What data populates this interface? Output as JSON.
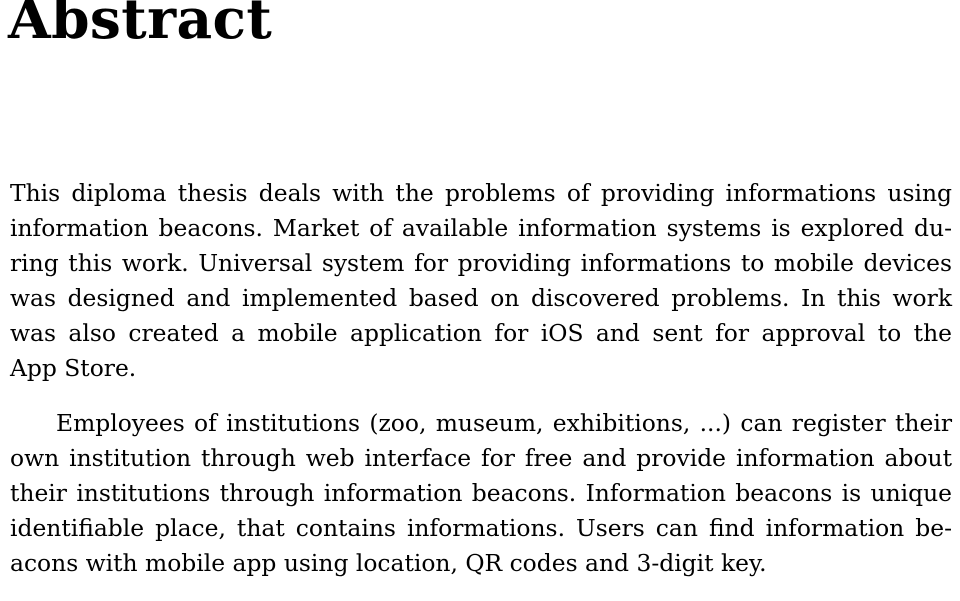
{
  "document": {
    "type": "thesis-abstract-page",
    "background_color": "#ffffff",
    "text_color": "#000000",
    "heading": "Abstract",
    "paragraphs": [
      {
        "id": "paragraph-1",
        "indent_first_line": false,
        "text": "This diploma thesis deals with the problems of providing informations using information beacons. Market of available information systems is explored during this work. Universal system for providing informations to mobile devices was designed and implemented based on discovered problems. In this work was also created a mobile application for iOS and sent for approval to the App Store.",
        "lines": [
          "This diploma thesis deals with the problems of providing informations using",
          "information beacons. Market of available information systems is explored du-",
          "ring this work. Universal system for providing informations to mobile devices",
          "was designed and implemented based on discovered problems. In this work",
          "was also created a mobile application for iOS and sent for approval to the",
          "App Store."
        ]
      },
      {
        "id": "paragraph-2",
        "indent_first_line": true,
        "text": "Employees of institutions (zoo, museum, exhibitions, ...) can register their own institution through web interface for free and provide information about their institutions through information beacons. Information beacons is unique identifiable place, that contains informations. Users can find information beacons with mobile app using location, QR codes and 3-digit key.",
        "lines": [
          "Employees of institutions (zoo, museum, exhibitions, ...) can register their",
          "own institution through web interface for free and provide information about",
          "their institutions through information beacons. Information beacons is unique",
          "identifiable place, that contains informations. Users can find information be-",
          "acons with mobile app using location, QR codes and 3-digit key."
        ]
      }
    ]
  }
}
